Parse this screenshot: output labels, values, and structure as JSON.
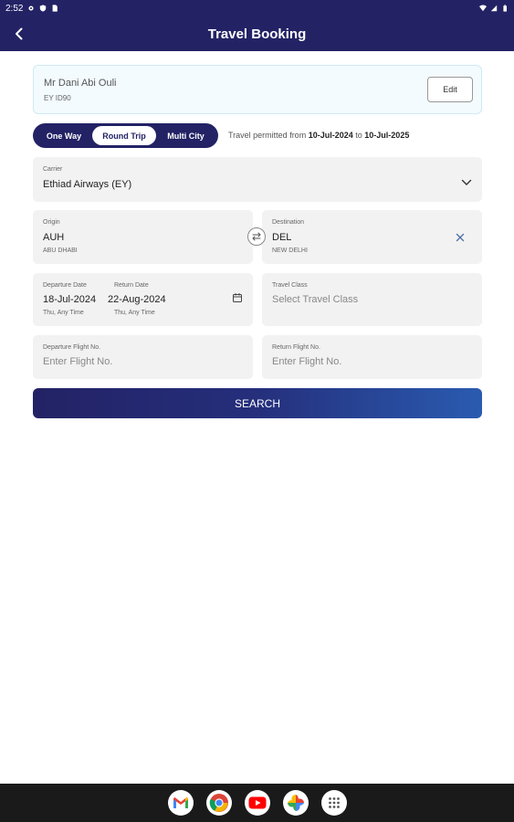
{
  "status_bar": {
    "time": "2:52"
  },
  "app_bar": {
    "title": "Travel Booking"
  },
  "user": {
    "name": "Mr Dani Abi Ouli",
    "id": "EY ID90",
    "edit_label": "Edit"
  },
  "trip_type": {
    "options": [
      "One Way",
      "Round Trip",
      "Multi City"
    ],
    "selected": "Round Trip"
  },
  "permit": {
    "prefix": "Travel permitted from",
    "from": "10-Jul-2024",
    "connector": "to",
    "to": "10-Jul-2025"
  },
  "carrier": {
    "label": "Carrier",
    "value": "Ethiad Airways (EY)"
  },
  "origin": {
    "label": "Origin",
    "code": "AUH",
    "city": "ABU DHABI"
  },
  "destination": {
    "label": "Destination",
    "code": "DEL",
    "city": "NEW DELHI"
  },
  "departure": {
    "label": "Departure Date",
    "date": "18-Jul-2024",
    "sub": "Thu, Any Time"
  },
  "return_date": {
    "label": "Return Date",
    "date": "22-Aug-2024",
    "sub": "Thu, Any Time"
  },
  "travel_class": {
    "label": "Travel Class",
    "placeholder": "Select Travel Class"
  },
  "departure_flight": {
    "label": "Departure Flight No.",
    "placeholder": "Enter Flight No."
  },
  "return_flight": {
    "label": "Return Flight No.",
    "placeholder": "Enter Flight No."
  },
  "search_label": "SEARCH",
  "dock": [
    "gmail-icon",
    "chrome-icon",
    "youtube-icon",
    "photos-icon",
    "app-drawer-icon"
  ],
  "colors": {
    "primary": "#232265",
    "accent": "#2a5bb0",
    "card": "#f3fbfe",
    "field": "#f2f2f2"
  }
}
